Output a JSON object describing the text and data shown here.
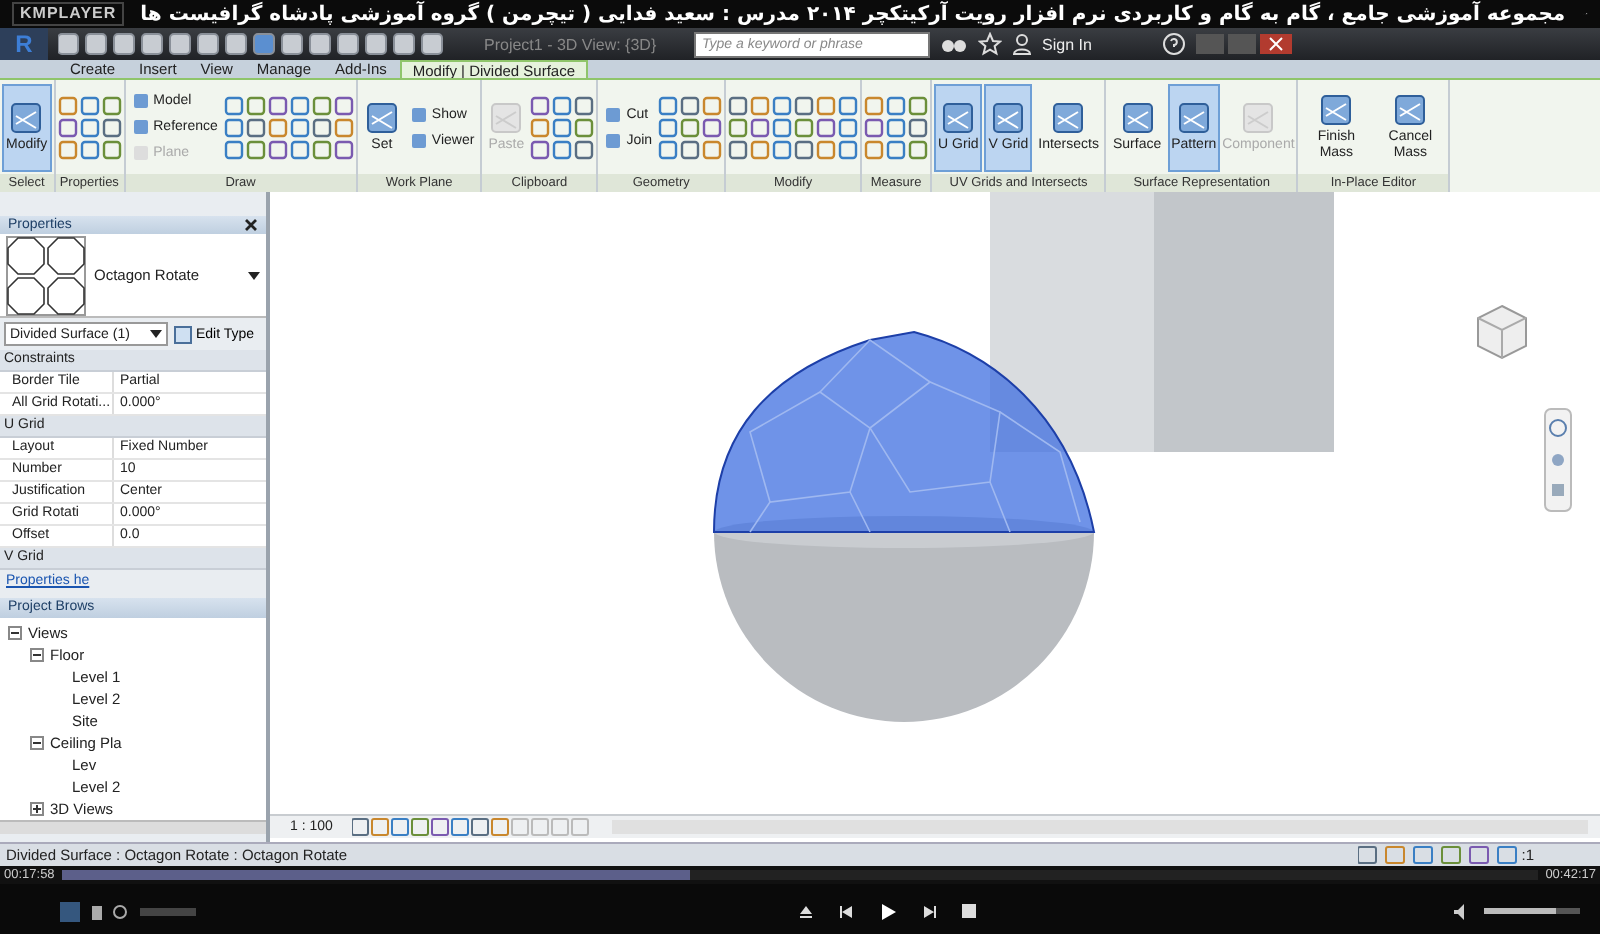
{
  "player": {
    "logo": "KMPLAYER",
    "title": "مجموعه آموزشی جامع ، گام به گام و کاربردی نرم افزار رویت آرکیتکچر ۲۰۱۴ مدرس : سعید فدایی ( تیچرمن ) گروه آموزشی پادشاه گرافیست ها",
    "elapsed": "00:17:58",
    "total": "00:42:17",
    "level": 0.425,
    "volume": {
      "level": 0.75
    }
  },
  "revit": {
    "app_button": "R",
    "document_title": "Project1 - 3D View: {3D}",
    "search": {
      "placeholder": "Type a keyword or phrase"
    },
    "sign_in": "Sign In"
  },
  "tabs": [
    {
      "label": "Create",
      "selected": false
    },
    {
      "label": "Insert",
      "selected": false
    },
    {
      "label": "View",
      "selected": false
    },
    {
      "label": "Manage",
      "selected": false
    },
    {
      "label": "Add-Ins",
      "selected": false
    },
    {
      "label": "Modify | Divided Surface",
      "selected": true
    }
  ],
  "ribbon_panels": [
    {
      "label": "Select",
      "groups": [
        {
          "kind": "large",
          "buttons": [
            {
              "label": "Modify",
              "selected": true,
              "disabled": false
            }
          ]
        }
      ]
    },
    {
      "label": "Properties",
      "groups": [
        {
          "kind": "tools"
        }
      ]
    },
    {
      "label": "Draw",
      "groups": [
        {
          "kind": "small",
          "buttons": [
            {
              "label": "Model",
              "selected": false,
              "disabled": false
            },
            {
              "label": "Reference",
              "selected": false,
              "disabled": false
            },
            {
              "label": "Plane",
              "selected": false,
              "disabled": true
            }
          ]
        },
        {
          "kind": "tools"
        },
        {
          "kind": "tools"
        }
      ]
    },
    {
      "label": "Work Plane",
      "groups": [
        {
          "kind": "large",
          "buttons": [
            {
              "label": "Set",
              "selected": false,
              "disabled": false
            }
          ]
        },
        {
          "kind": "small",
          "buttons": [
            {
              "label": "Show",
              "selected": false,
              "disabled": false
            },
            {
              "label": "Viewer",
              "selected": false,
              "disabled": false
            }
          ]
        }
      ]
    },
    {
      "label": "Clipboard",
      "groups": [
        {
          "kind": "large",
          "buttons": [
            {
              "label": "Paste",
              "selected": false,
              "disabled": true
            }
          ]
        },
        {
          "kind": "tools"
        }
      ]
    },
    {
      "label": "Geometry",
      "groups": [
        {
          "kind": "small",
          "buttons": [
            {
              "label": "Cut",
              "selected": false,
              "disabled": false
            },
            {
              "label": "Join",
              "selected": false,
              "disabled": false
            }
          ]
        },
        {
          "kind": "tools"
        }
      ]
    },
    {
      "label": "Modify",
      "groups": [
        {
          "kind": "tools"
        },
        {
          "kind": "tools"
        }
      ]
    },
    {
      "label": "Measure",
      "groups": [
        {
          "kind": "tools"
        }
      ]
    },
    {
      "label": "UV Grids and Intersects",
      "groups": [
        {
          "kind": "large",
          "buttons": [
            {
              "label": "U Grid",
              "selected": true,
              "disabled": false
            },
            {
              "label": "V Grid",
              "selected": true,
              "disabled": false
            },
            {
              "label": "Intersects",
              "selected": false,
              "disabled": false
            }
          ]
        }
      ]
    },
    {
      "label": "Surface Representation",
      "groups": [
        {
          "kind": "large",
          "buttons": [
            {
              "label": "Surface",
              "selected": false,
              "disabled": false
            },
            {
              "label": "Pattern",
              "selected": true,
              "disabled": false
            },
            {
              "label": "Component",
              "selected": false,
              "disabled": true
            }
          ]
        }
      ]
    },
    {
      "label": "In-Place Editor",
      "groups": [
        {
          "kind": "large",
          "buttons": [
            {
              "label": "Finish Mass",
              "selected": false,
              "disabled": false
            },
            {
              "label": "Cancel Mass",
              "selected": false,
              "disabled": false
            }
          ]
        }
      ]
    }
  ],
  "properties": {
    "title": "Properties",
    "type_name": "Octagon Rotate",
    "instance": "Divided Surface (1)",
    "edit_type": "Edit Type",
    "groups": [
      {
        "name": "Constraints",
        "rows": [
          {
            "label": "Border Tile",
            "value": "Partial"
          },
          {
            "label": "All Grid Rotati...",
            "value": "0.000°"
          }
        ]
      },
      {
        "name": "U Grid",
        "rows": [
          {
            "label": "Layout",
            "value": "Fixed Number"
          },
          {
            "label": "Number",
            "value": "10"
          },
          {
            "label": "Justification",
            "value": "Center"
          },
          {
            "label": "Grid Rotati",
            "value": "0.000°"
          },
          {
            "label": "Offset",
            "value": "0.0"
          }
        ]
      },
      {
        "name": "V Grid"
      }
    ],
    "help_link": "Properties he"
  },
  "project_browser": {
    "title": "Project Brows",
    "tree": [
      {
        "label": "Views",
        "expanded": true,
        "children": [
          {
            "label": "Floor",
            "expanded": true,
            "children": [
              {
                "label": "Level 1"
              },
              {
                "label": "Level 2"
              },
              {
                "label": "Site"
              }
            ]
          },
          {
            "label": "Ceiling Pla",
            "expanded": true,
            "children": [
              {
                "label": "Lev"
              },
              {
                "label": "Level 2"
              }
            ]
          },
          {
            "label": "3D Views",
            "expanded": false
          }
        ]
      }
    ]
  },
  "viewport": {
    "scale": "1 : 100"
  },
  "status_bar": {
    "text": "Divided Surface : Octagon Rotate : Octagon Rotate",
    "filter_count": ":1"
  }
}
